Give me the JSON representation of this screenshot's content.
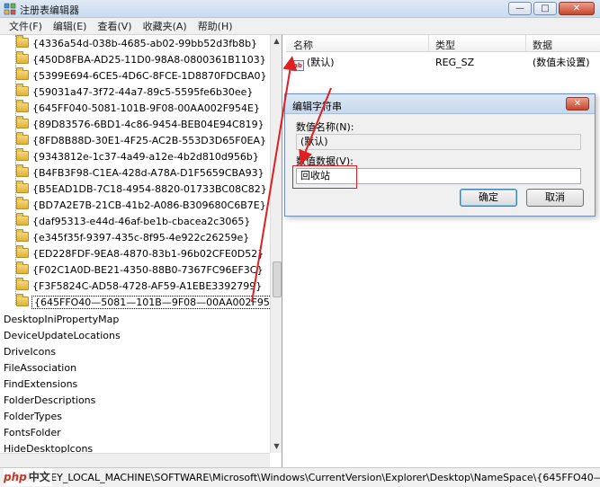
{
  "window": {
    "title": "注册表编辑器",
    "minimize": "—",
    "maximize": "□",
    "close": "✕"
  },
  "menu": [
    "文件(F)",
    "编辑(E)",
    "查看(V)",
    "收藏夹(A)",
    "帮助(H)"
  ],
  "tree": {
    "guid_items": [
      "{4336a54d-038b-4685-ab02-99bb52d3fb8b}",
      "{450D8FBA-AD25-11D0-98A8-0800361B1103}",
      "{5399E694-6CE5-4D6C-8FCE-1D8870FDCBA0}",
      "{59031a47-3f72-44a7-89c5-5595fe6b30ee}",
      "{645FF040-5081-101B-9F08-00AA002F954E}",
      "{89D83576-6BD1-4c86-9454-BEB04E94C819}",
      "{8FD8B88D-30E1-4F25-AC2B-553D3D65F0EA}",
      "{9343812e-1c37-4a49-a12e-4b2d810d956b}",
      "{B4FB3F98-C1EA-428d-A78A-D1F5659CBA93}",
      "{B5EAD1DB-7C18-4954-8820-01733BC08C82}",
      "{BD7A2E7B-21CB-41b2-A086-B309680C6B7E}",
      "{daf95313-e44d-46af-be1b-cbacea2c3065}",
      "{e345f35f-9397-435c-8f95-4e922c26259e}",
      "{ED228FDF-9EA8-4870-83b1-96b02CFE0D52}",
      "{F02C1A0D-BE21-4350-88B0-7367FC96EF3C}",
      "{F3F5824C-AD58-4728-AF59-A1EBE3392799}",
      "{645FFO40—5081—101B—9F08—00AA002F954E}"
    ],
    "top_items": [
      "DesktopIniPropertyMap",
      "DeviceUpdateLocations",
      "DriveIcons",
      "FileAssociation",
      "FindExtensions",
      "FolderDescriptions",
      "FolderTypes",
      "FontsFolder",
      "HideDesktopIcons"
    ]
  },
  "list": {
    "columns": [
      "名称",
      "类型",
      "数据"
    ],
    "rows": [
      {
        "name": "(默认)",
        "type": "REG_SZ",
        "data": "(数值未设置)"
      }
    ]
  },
  "dialog": {
    "title": "编辑字符串",
    "close": "✕",
    "name_label": "数值名称(N):",
    "name_value": "(默认)",
    "data_label": "数值数据(V):",
    "data_value": "回收站",
    "ok": "确定",
    "cancel": "取消"
  },
  "statusbar": {
    "path": "计算机\\HKEY_LOCAL_MACHINE\\SOFTWARE\\Microsoft\\Windows\\CurrentVersion\\Explorer\\Desktop\\NameSpace\\{645FFO40—50"
  },
  "watermark": {
    "php": "php",
    "text": "中文网"
  },
  "colors": {
    "annotation": "#e02020",
    "folder": "#dfb23a"
  }
}
